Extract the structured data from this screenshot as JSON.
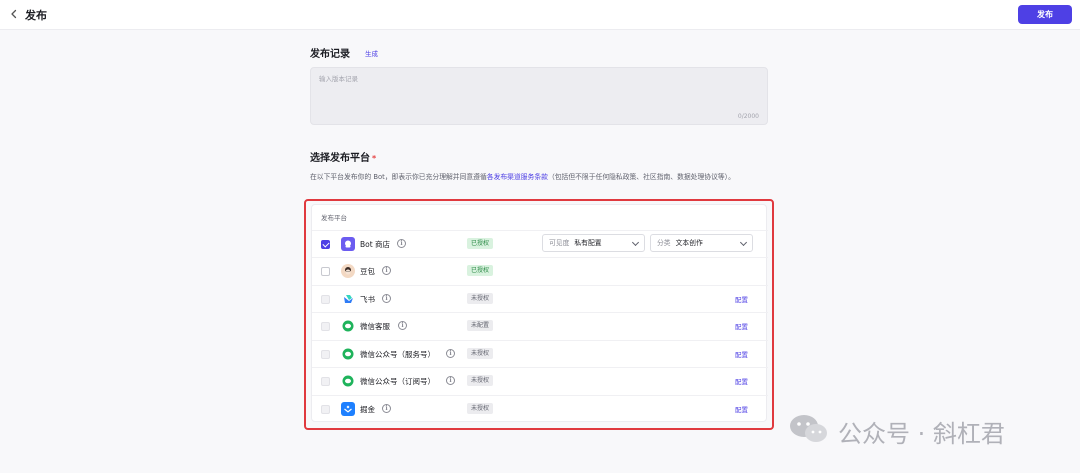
{
  "header": {
    "title": "发布",
    "publish_label": "发布"
  },
  "record": {
    "title": "发布记录",
    "generate_label": "生成",
    "placeholder": "输入版本记录",
    "count": "0/2000"
  },
  "platform_section": {
    "title": "选择发布平台",
    "required_mark": "*",
    "desc_prefix": "在以下平台发布你的 Bot，即表示你已充分理解并同意遵循",
    "desc_link": "各发布渠道服务条款",
    "desc_suffix": "（包括但不限于任何隐私政策、社区指南、数据处理协议等）。"
  },
  "table": {
    "header": "发布平台",
    "rows": [
      {
        "name": "Bot 商店",
        "status": "已授权",
        "status_type": "auth",
        "checked": true,
        "disabled": false,
        "icon": "bot-store-icon",
        "icon_color": "#6b5cf0"
      },
      {
        "name": "豆包",
        "status": "已授权",
        "status_type": "auth",
        "checked": false,
        "disabled": false,
        "icon": "doubao-icon",
        "icon_color": "#f3d9c4"
      },
      {
        "name": "飞书",
        "status": "未授权",
        "status_type": "unauth",
        "checked": false,
        "disabled": true,
        "icon": "feishu-icon",
        "icon_color": "#2f7cf6",
        "config": "配置"
      },
      {
        "name": "微信客服",
        "status": "未配置",
        "status_type": "unauth",
        "checked": false,
        "disabled": true,
        "icon": "wechat-icon",
        "icon_color": "#1fb35b",
        "config": "配置"
      },
      {
        "name": "微信公众号（服务号）",
        "status": "未授权",
        "status_type": "unauth",
        "checked": false,
        "disabled": true,
        "icon": "wechat-icon",
        "icon_color": "#1fb35b",
        "config": "配置"
      },
      {
        "name": "微信公众号（订阅号）",
        "status": "未授权",
        "status_type": "unauth",
        "checked": false,
        "disabled": true,
        "icon": "wechat-icon",
        "icon_color": "#1fb35b",
        "config": "配置"
      },
      {
        "name": "掘金",
        "status": "未授权",
        "status_type": "unauth",
        "checked": false,
        "disabled": true,
        "icon": "juejin-icon",
        "icon_color": "#1e80ff",
        "config": "配置"
      }
    ],
    "visibility": {
      "label": "可见度",
      "value": "私有配置"
    },
    "category": {
      "label": "分类",
      "value": "文本创作"
    }
  },
  "watermark": {
    "text": "公众号 · 斜杠君"
  },
  "colors": {
    "accent": "#4e40e5",
    "highlight": "#e0393e"
  }
}
